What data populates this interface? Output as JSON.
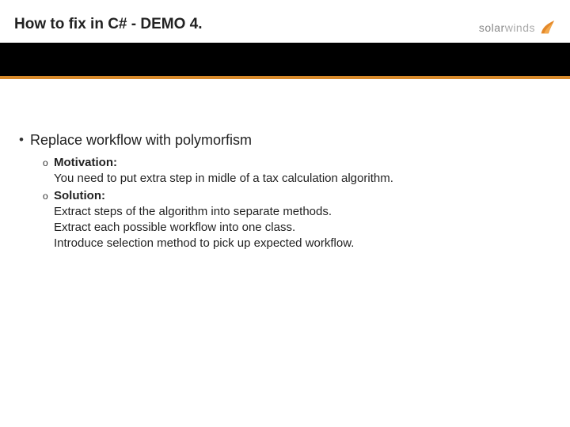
{
  "header": {
    "title": "How to fix in C# - DEMO 4.",
    "brand_left": "solar",
    "brand_right": "winds"
  },
  "content": {
    "bullet": "Replace workflow with polymorfism",
    "items": [
      {
        "label": "Motivation:",
        "body": "You need to put extra step in midle of a tax calculation algorithm."
      },
      {
        "label": "Solution:",
        "body": "Extract steps of the algorithm into separate methods.\nExtract each possible workflow into one class.\nIntroduce selection method to pick up expected workflow."
      }
    ]
  }
}
